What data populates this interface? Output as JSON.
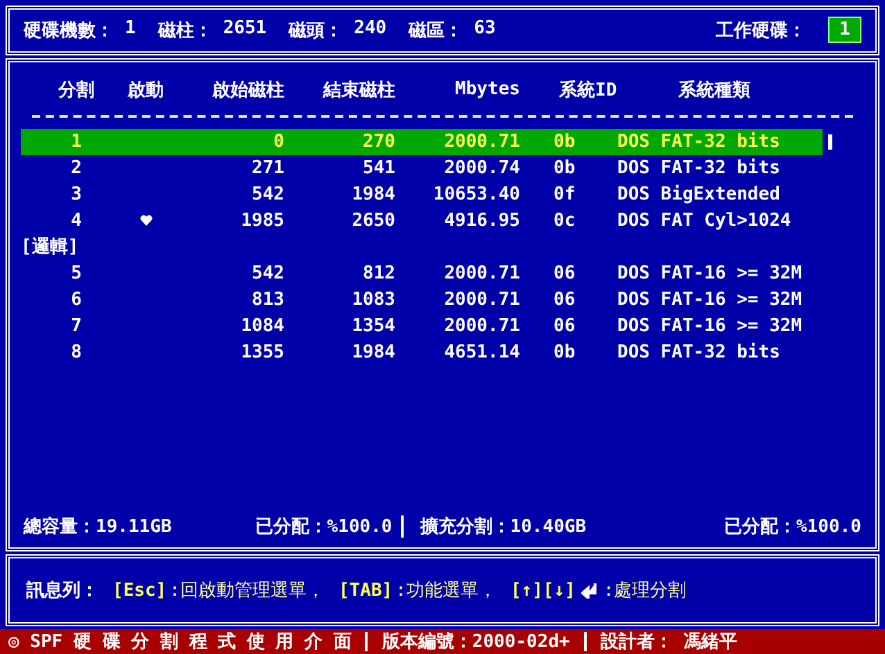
{
  "header": {
    "fields": [
      {
        "label": "硬碟機數：",
        "value": "1"
      },
      {
        "label": "磁柱：",
        "value": "2651"
      },
      {
        "label": "磁頭：",
        "value": "240"
      },
      {
        "label": "磁區：",
        "value": "63"
      }
    ],
    "working_disk": {
      "label": "工作硬碟：",
      "value": "1"
    }
  },
  "table": {
    "columns": [
      "分割",
      "啟動",
      "啟始磁柱",
      "結束磁柱",
      "Mbytes",
      "系統ID",
      "系統種類"
    ],
    "rows": [
      {
        "kind": "partition",
        "selected": true,
        "boot": false,
        "cells": [
          "1",
          "0",
          "270",
          "2000.71",
          "0b",
          "DOS FAT-32 bits"
        ]
      },
      {
        "kind": "partition",
        "selected": false,
        "boot": false,
        "cells": [
          "2",
          "271",
          "541",
          "2000.74",
          "0b",
          "DOS FAT-32 bits"
        ]
      },
      {
        "kind": "partition",
        "selected": false,
        "boot": false,
        "cells": [
          "3",
          "542",
          "1984",
          "10653.40",
          "0f",
          "DOS BigExtended"
        ]
      },
      {
        "kind": "partition",
        "selected": false,
        "boot": true,
        "cells": [
          "4",
          "1985",
          "2650",
          "4916.95",
          "0c",
          "DOS FAT Cyl>1024"
        ]
      },
      {
        "kind": "group",
        "label": "[邏輯]"
      },
      {
        "kind": "partition",
        "selected": false,
        "boot": false,
        "cells": [
          "5",
          "542",
          "812",
          "2000.71",
          "06",
          "DOS FAT-16 >= 32M"
        ]
      },
      {
        "kind": "partition",
        "selected": false,
        "boot": false,
        "cells": [
          "6",
          "813",
          "1083",
          "2000.71",
          "06",
          "DOS FAT-16 >= 32M"
        ]
      },
      {
        "kind": "partition",
        "selected": false,
        "boot": false,
        "cells": [
          "7",
          "1084",
          "1354",
          "2000.71",
          "06",
          "DOS FAT-16 >= 32M"
        ]
      },
      {
        "kind": "partition",
        "selected": false,
        "boot": false,
        "cells": [
          "8",
          "1355",
          "1984",
          "4651.14",
          "0b",
          "DOS FAT-32 bits"
        ]
      }
    ]
  },
  "summary": {
    "total": "總容量：19.11GB",
    "allocated": "已分配：%100.0",
    "extended": "擴充分割：10.40GB",
    "extended_allocated": "已分配：%100.0"
  },
  "message_bar": {
    "label": "訊息列：",
    "parts": [
      {
        "kind": "key",
        "text": "[Esc]"
      },
      {
        "kind": "text",
        "text": ":回啟動管理選單，"
      },
      {
        "kind": "key",
        "text": "[TAB]"
      },
      {
        "kind": "text",
        "text": ":功能選單，"
      },
      {
        "kind": "key",
        "text": "[↑][↓]"
      },
      {
        "kind": "enter_icon"
      },
      {
        "kind": "text",
        "text": ":處理分割"
      }
    ]
  },
  "status_bar": [
    "◎ SPF 硬 碟 分 割 程 式 使 用 介 面",
    "版本編號：2000-02d+",
    "設計者： 馮緒平"
  ]
}
